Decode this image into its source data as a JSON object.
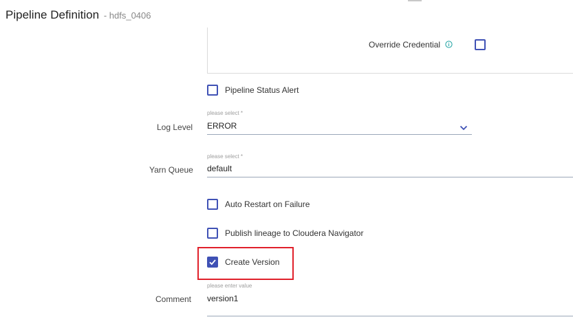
{
  "header": {
    "title": "Pipeline Definition",
    "subtitle": "- hdfs_0406"
  },
  "credentials": {
    "override_label": "Override Credential",
    "override_checked": false
  },
  "options": {
    "pipeline_status_alert": {
      "label": "Pipeline Status Alert",
      "checked": false
    },
    "auto_restart": {
      "label": "Auto Restart on Failure",
      "checked": false
    },
    "publish_lineage": {
      "label": "Publish lineage to Cloudera Navigator",
      "checked": false
    },
    "create_version": {
      "label": "Create Version",
      "checked": true
    }
  },
  "log_level": {
    "label": "Log Level",
    "placeholder": "please select *",
    "value": "ERROR"
  },
  "yarn_queue": {
    "label": "Yarn Queue",
    "placeholder": "please select *",
    "value": "default"
  },
  "comment": {
    "label": "Comment",
    "placeholder": "please enter value",
    "value": "version1"
  },
  "colors": {
    "accent": "#3f51b5",
    "highlight": "#e0202a",
    "info": "#1aa0a0"
  }
}
